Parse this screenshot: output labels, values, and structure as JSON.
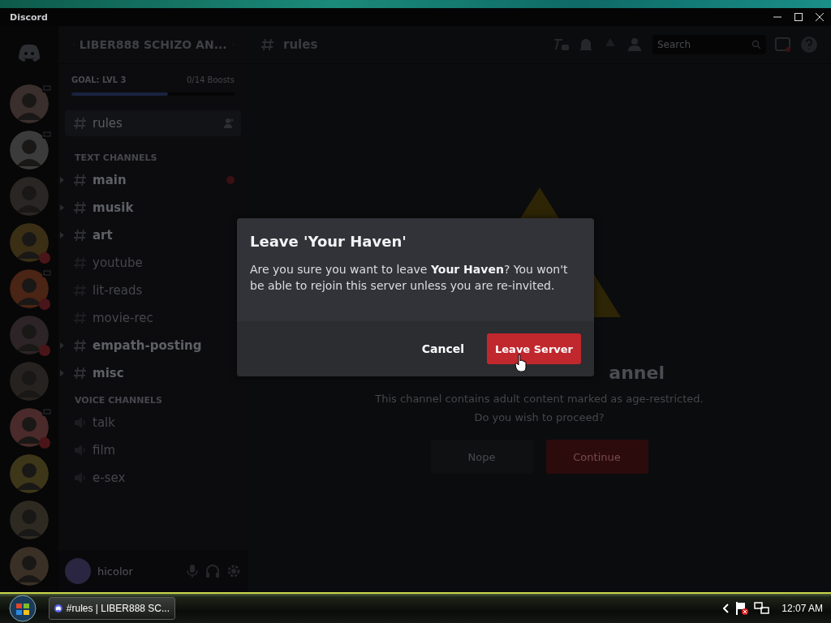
{
  "window": {
    "title": "Discord"
  },
  "server_list": {
    "servers": [
      {
        "live": true,
        "mention": false
      },
      {
        "live": true,
        "mention": false
      },
      {
        "live": false,
        "mention": false
      },
      {
        "live": false,
        "mention": true
      },
      {
        "live": true,
        "mention": true
      },
      {
        "live": false,
        "mention": true
      },
      {
        "live": false,
        "mention": false
      },
      {
        "live": true,
        "mention": true
      },
      {
        "live": false,
        "mention": false
      },
      {
        "live": false,
        "mention": false
      },
      {
        "live": false,
        "mention": false
      }
    ]
  },
  "server_header": {
    "name": "LIBER888 SCHIZO AN..."
  },
  "boost_goal": {
    "label": "GOAL: LVL 3",
    "progress": "0/14 Boosts",
    "level": 0.59
  },
  "channels": [
    {
      "kind": "text",
      "name": "rules",
      "selected": true,
      "unread": false,
      "expandable": false,
      "mention": false
    },
    {
      "kind": "category",
      "name": "TEXT CHANNELS"
    },
    {
      "kind": "text",
      "name": "main",
      "selected": false,
      "unread": true,
      "expandable": true,
      "mention": true
    },
    {
      "kind": "text",
      "name": "musik",
      "selected": false,
      "unread": true,
      "expandable": true,
      "mention": false
    },
    {
      "kind": "text",
      "name": "art",
      "selected": false,
      "unread": true,
      "expandable": true,
      "mention": false
    },
    {
      "kind": "text",
      "name": "youtube",
      "selected": false,
      "unread": false,
      "expandable": false,
      "mention": false
    },
    {
      "kind": "text",
      "name": "lit-reads",
      "selected": false,
      "unread": false,
      "expandable": false,
      "mention": false
    },
    {
      "kind": "text",
      "name": "movie-rec",
      "selected": false,
      "unread": false,
      "expandable": false,
      "mention": false
    },
    {
      "kind": "text",
      "name": "empath-posting",
      "selected": false,
      "unread": true,
      "expandable": true,
      "mention": false
    },
    {
      "kind": "text",
      "name": "misc",
      "selected": false,
      "unread": true,
      "expandable": true,
      "mention": false
    },
    {
      "kind": "category",
      "name": "VOICE CHANNELS"
    },
    {
      "kind": "voice",
      "name": "talk",
      "selected": false,
      "unread": false,
      "expandable": false,
      "mention": false
    },
    {
      "kind": "voice",
      "name": "film",
      "selected": false,
      "unread": false,
      "expandable": false,
      "mention": false
    },
    {
      "kind": "voice",
      "name": "e-sex",
      "selected": false,
      "unread": false,
      "expandable": false,
      "mention": false
    }
  ],
  "user_panel": {
    "username": "hicolor"
  },
  "channel_header": {
    "name": "rules",
    "search": {
      "placeholder": "Search"
    }
  },
  "age_gate": {
    "heading_visible": "annel",
    "text": "This channel contains adult content marked as age-restricted.",
    "question": "Do you wish to proceed?",
    "buttons": [
      "Nope",
      "Continue"
    ]
  },
  "dialog": {
    "title": "Leave 'Your Haven'",
    "body": "Are you sure you want to leave **Your Haven**? You won't be able to rejoin this server unless you are re-invited.",
    "cancel": "Cancel",
    "confirm": "Leave Server"
  },
  "taskbar": {
    "task": "#rules | LIBER888 SC...",
    "clock": "12:07 AM"
  }
}
